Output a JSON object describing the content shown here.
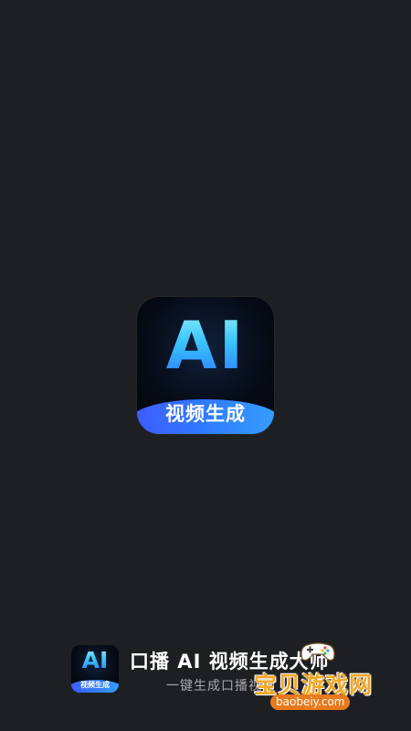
{
  "splash": {
    "icon": {
      "name": "ai-video-app-icon",
      "big_text": "AI",
      "ribbon_text": "视频生成"
    }
  },
  "brand": {
    "icon": {
      "big_text": "AI",
      "ribbon_text": "视频生成"
    },
    "app_name": "口播 AI 视频生成大师",
    "slogan": "一键生成口播视频"
  },
  "watermark": {
    "text": "宝贝游戏网",
    "url": "baobeiy.com",
    "icon": "game-controller-icon"
  },
  "colors": {
    "background": "#1e1f22",
    "ai_gradient_top": "#9df5ff",
    "ai_gradient_bottom": "#2b6dff",
    "ribbon_start": "#3f5bff",
    "ribbon_end": "#36a0ff",
    "watermark_orange": "#f5a623"
  }
}
